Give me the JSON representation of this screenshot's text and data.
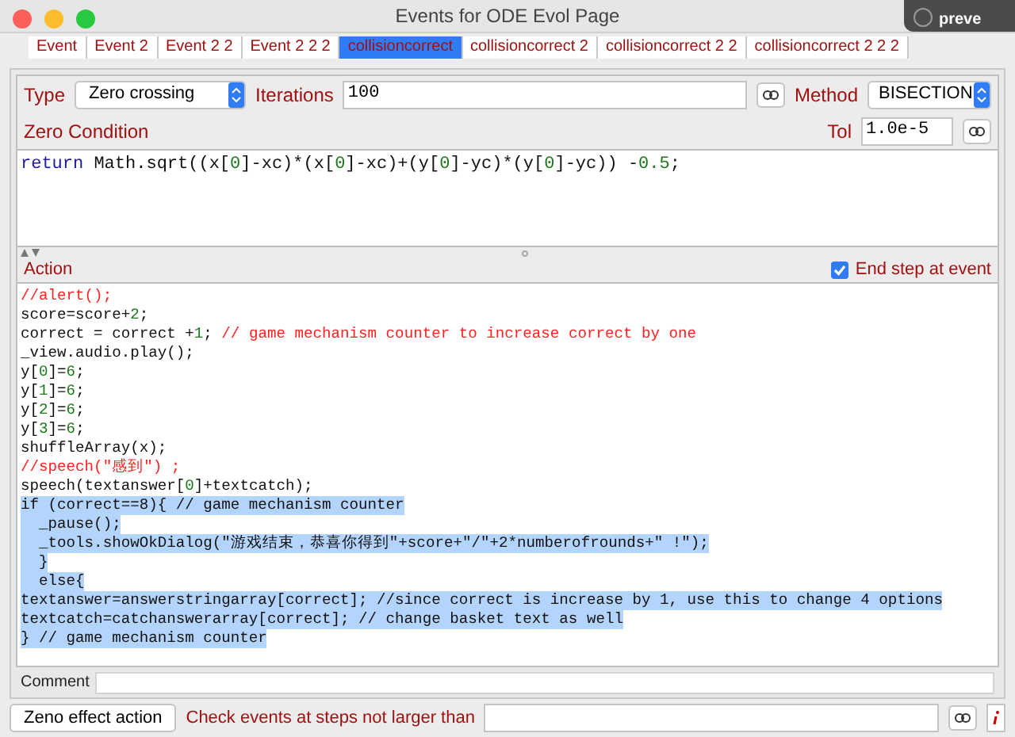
{
  "window": {
    "title": "Events for ODE Evol Page"
  },
  "notification": {
    "text": "preve"
  },
  "tabs": [
    {
      "label": "Event",
      "selected": false
    },
    {
      "label": "Event 2",
      "selected": false
    },
    {
      "label": "Event 2 2",
      "selected": false
    },
    {
      "label": "Event 2 2 2",
      "selected": false
    },
    {
      "label": "collisioncorrect",
      "selected": true
    },
    {
      "label": "collisioncorrect 2",
      "selected": false
    },
    {
      "label": "collisioncorrect 2 2",
      "selected": false
    },
    {
      "label": "collisioncorrect 2 2 2",
      "selected": false
    }
  ],
  "type": {
    "label": "Type",
    "value": "Zero crossing"
  },
  "iterations": {
    "label": "Iterations",
    "value": "100"
  },
  "method": {
    "label": "Method",
    "value": "BISECTION"
  },
  "zero_condition": {
    "label": "Zero Condition",
    "tol_label": "Tol",
    "tol_value": "1.0e-5",
    "lines": [
      {
        "selected": false,
        "segments": [
          {
            "kind": "keyword",
            "text": "return"
          },
          {
            "kind": "plain",
            "text": " Math.sqrt((x["
          },
          {
            "kind": "number",
            "text": "0"
          },
          {
            "kind": "plain",
            "text": "]-xc)*(x["
          },
          {
            "kind": "number",
            "text": "0"
          },
          {
            "kind": "plain",
            "text": "]-xc)+(y["
          },
          {
            "kind": "number",
            "text": "0"
          },
          {
            "kind": "plain",
            "text": "]-yc)*(y["
          },
          {
            "kind": "number",
            "text": "0"
          },
          {
            "kind": "plain",
            "text": "]-yc)) -"
          },
          {
            "kind": "number",
            "text": "0.5"
          },
          {
            "kind": "plain",
            "text": ";"
          }
        ]
      }
    ]
  },
  "action": {
    "label": "Action",
    "end_step": {
      "label": "End step at event",
      "checked": true
    },
    "lines": [
      {
        "selected": false,
        "segments": [
          {
            "kind": "comment",
            "text": "//alert();"
          }
        ]
      },
      {
        "selected": false,
        "segments": [
          {
            "kind": "plain",
            "text": "score=score+"
          },
          {
            "kind": "number",
            "text": "2"
          },
          {
            "kind": "plain",
            "text": ";"
          }
        ]
      },
      {
        "selected": false,
        "segments": [
          {
            "kind": "plain",
            "text": "correct = correct +"
          },
          {
            "kind": "number",
            "text": "1"
          },
          {
            "kind": "plain",
            "text": "; "
          },
          {
            "kind": "comment",
            "text": "// game mechanism counter to increase correct by one"
          }
        ]
      },
      {
        "selected": false,
        "segments": [
          {
            "kind": "plain",
            "text": "_view.audio.play();"
          }
        ]
      },
      {
        "selected": false,
        "segments": [
          {
            "kind": "plain",
            "text": "y["
          },
          {
            "kind": "number",
            "text": "0"
          },
          {
            "kind": "plain",
            "text": "]="
          },
          {
            "kind": "number",
            "text": "6"
          },
          {
            "kind": "plain",
            "text": ";"
          }
        ]
      },
      {
        "selected": false,
        "segments": [
          {
            "kind": "plain",
            "text": "y["
          },
          {
            "kind": "number",
            "text": "1"
          },
          {
            "kind": "plain",
            "text": "]="
          },
          {
            "kind": "number",
            "text": "6"
          },
          {
            "kind": "plain",
            "text": ";"
          }
        ]
      },
      {
        "selected": false,
        "segments": [
          {
            "kind": "plain",
            "text": "y["
          },
          {
            "kind": "number",
            "text": "2"
          },
          {
            "kind": "plain",
            "text": "]="
          },
          {
            "kind": "number",
            "text": "6"
          },
          {
            "kind": "plain",
            "text": ";"
          }
        ]
      },
      {
        "selected": false,
        "segments": [
          {
            "kind": "plain",
            "text": "y["
          },
          {
            "kind": "number",
            "text": "3"
          },
          {
            "kind": "plain",
            "text": "]="
          },
          {
            "kind": "number",
            "text": "6"
          },
          {
            "kind": "plain",
            "text": ";"
          }
        ]
      },
      {
        "selected": false,
        "segments": [
          {
            "kind": "plain",
            "text": "shuffleArray(x);"
          }
        ]
      },
      {
        "selected": false,
        "segments": [
          {
            "kind": "comment",
            "text": "//speech(\"感到\") ;"
          }
        ]
      },
      {
        "selected": false,
        "segments": [
          {
            "kind": "plain",
            "text": "speech(textanswer["
          },
          {
            "kind": "number",
            "text": "0"
          },
          {
            "kind": "plain",
            "text": "]+textcatch);"
          }
        ]
      },
      {
        "selected": true,
        "segments": [
          {
            "kind": "plain",
            "text": "if (correct==8){ // game mechanism counter"
          }
        ]
      },
      {
        "selected": true,
        "segments": [
          {
            "kind": "plain",
            "text": "  _pause();"
          }
        ]
      },
      {
        "selected": true,
        "segments": [
          {
            "kind": "plain",
            "text": "  _tools.showOkDialog(\"游戏结束，恭喜你得到\"+score+\"/\"+2*numberofrounds+\" !\");"
          }
        ]
      },
      {
        "selected": true,
        "segments": [
          {
            "kind": "plain",
            "text": "  }"
          }
        ]
      },
      {
        "selected": true,
        "segments": [
          {
            "kind": "plain",
            "text": "  else{"
          }
        ]
      },
      {
        "selected": true,
        "segments": [
          {
            "kind": "plain",
            "text": "textanswer=answerstringarray[correct]; //since correct is increase by 1, use this to change 4 options"
          }
        ]
      },
      {
        "selected": true,
        "segments": [
          {
            "kind": "plain",
            "text": "textcatch=catchanswerarray[correct]; // change basket text as well"
          }
        ]
      },
      {
        "selected": true,
        "segments": [
          {
            "kind": "plain",
            "text": "} // game mechanism counter"
          }
        ]
      }
    ]
  },
  "comment": {
    "label": "Comment"
  },
  "bottom": {
    "zeno_button": "Zeno effect action",
    "check_label": "Check events at steps not larger than"
  }
}
